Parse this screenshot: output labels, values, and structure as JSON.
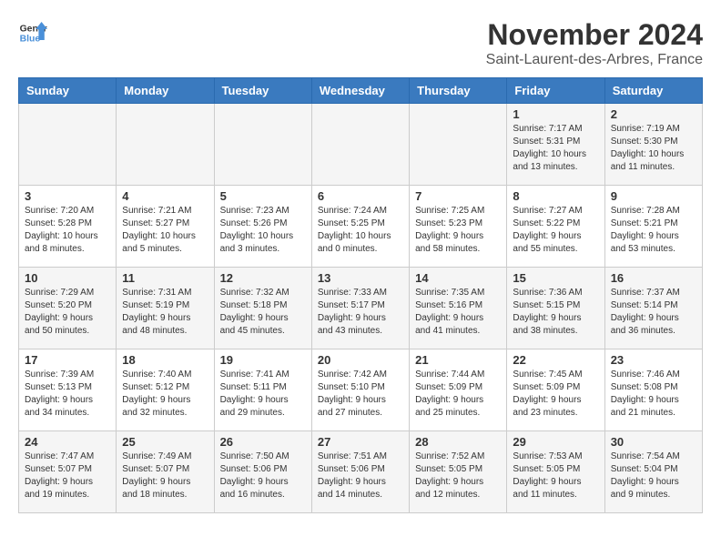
{
  "header": {
    "logo_general": "General",
    "logo_blue": "Blue",
    "month": "November 2024",
    "location": "Saint-Laurent-des-Arbres, France"
  },
  "weekdays": [
    "Sunday",
    "Monday",
    "Tuesday",
    "Wednesday",
    "Thursday",
    "Friday",
    "Saturday"
  ],
  "weeks": [
    [
      {
        "day": "",
        "content": ""
      },
      {
        "day": "",
        "content": ""
      },
      {
        "day": "",
        "content": ""
      },
      {
        "day": "",
        "content": ""
      },
      {
        "day": "",
        "content": ""
      },
      {
        "day": "1",
        "content": "Sunrise: 7:17 AM\nSunset: 5:31 PM\nDaylight: 10 hours and 13 minutes."
      },
      {
        "day": "2",
        "content": "Sunrise: 7:19 AM\nSunset: 5:30 PM\nDaylight: 10 hours and 11 minutes."
      }
    ],
    [
      {
        "day": "3",
        "content": "Sunrise: 7:20 AM\nSunset: 5:28 PM\nDaylight: 10 hours and 8 minutes."
      },
      {
        "day": "4",
        "content": "Sunrise: 7:21 AM\nSunset: 5:27 PM\nDaylight: 10 hours and 5 minutes."
      },
      {
        "day": "5",
        "content": "Sunrise: 7:23 AM\nSunset: 5:26 PM\nDaylight: 10 hours and 3 minutes."
      },
      {
        "day": "6",
        "content": "Sunrise: 7:24 AM\nSunset: 5:25 PM\nDaylight: 10 hours and 0 minutes."
      },
      {
        "day": "7",
        "content": "Sunrise: 7:25 AM\nSunset: 5:23 PM\nDaylight: 9 hours and 58 minutes."
      },
      {
        "day": "8",
        "content": "Sunrise: 7:27 AM\nSunset: 5:22 PM\nDaylight: 9 hours and 55 minutes."
      },
      {
        "day": "9",
        "content": "Sunrise: 7:28 AM\nSunset: 5:21 PM\nDaylight: 9 hours and 53 minutes."
      }
    ],
    [
      {
        "day": "10",
        "content": "Sunrise: 7:29 AM\nSunset: 5:20 PM\nDaylight: 9 hours and 50 minutes."
      },
      {
        "day": "11",
        "content": "Sunrise: 7:31 AM\nSunset: 5:19 PM\nDaylight: 9 hours and 48 minutes."
      },
      {
        "day": "12",
        "content": "Sunrise: 7:32 AM\nSunset: 5:18 PM\nDaylight: 9 hours and 45 minutes."
      },
      {
        "day": "13",
        "content": "Sunrise: 7:33 AM\nSunset: 5:17 PM\nDaylight: 9 hours and 43 minutes."
      },
      {
        "day": "14",
        "content": "Sunrise: 7:35 AM\nSunset: 5:16 PM\nDaylight: 9 hours and 41 minutes."
      },
      {
        "day": "15",
        "content": "Sunrise: 7:36 AM\nSunset: 5:15 PM\nDaylight: 9 hours and 38 minutes."
      },
      {
        "day": "16",
        "content": "Sunrise: 7:37 AM\nSunset: 5:14 PM\nDaylight: 9 hours and 36 minutes."
      }
    ],
    [
      {
        "day": "17",
        "content": "Sunrise: 7:39 AM\nSunset: 5:13 PM\nDaylight: 9 hours and 34 minutes."
      },
      {
        "day": "18",
        "content": "Sunrise: 7:40 AM\nSunset: 5:12 PM\nDaylight: 9 hours and 32 minutes."
      },
      {
        "day": "19",
        "content": "Sunrise: 7:41 AM\nSunset: 5:11 PM\nDaylight: 9 hours and 29 minutes."
      },
      {
        "day": "20",
        "content": "Sunrise: 7:42 AM\nSunset: 5:10 PM\nDaylight: 9 hours and 27 minutes."
      },
      {
        "day": "21",
        "content": "Sunrise: 7:44 AM\nSunset: 5:09 PM\nDaylight: 9 hours and 25 minutes."
      },
      {
        "day": "22",
        "content": "Sunrise: 7:45 AM\nSunset: 5:09 PM\nDaylight: 9 hours and 23 minutes."
      },
      {
        "day": "23",
        "content": "Sunrise: 7:46 AM\nSunset: 5:08 PM\nDaylight: 9 hours and 21 minutes."
      }
    ],
    [
      {
        "day": "24",
        "content": "Sunrise: 7:47 AM\nSunset: 5:07 PM\nDaylight: 9 hours and 19 minutes."
      },
      {
        "day": "25",
        "content": "Sunrise: 7:49 AM\nSunset: 5:07 PM\nDaylight: 9 hours and 18 minutes."
      },
      {
        "day": "26",
        "content": "Sunrise: 7:50 AM\nSunset: 5:06 PM\nDaylight: 9 hours and 16 minutes."
      },
      {
        "day": "27",
        "content": "Sunrise: 7:51 AM\nSunset: 5:06 PM\nDaylight: 9 hours and 14 minutes."
      },
      {
        "day": "28",
        "content": "Sunrise: 7:52 AM\nSunset: 5:05 PM\nDaylight: 9 hours and 12 minutes."
      },
      {
        "day": "29",
        "content": "Sunrise: 7:53 AM\nSunset: 5:05 PM\nDaylight: 9 hours and 11 minutes."
      },
      {
        "day": "30",
        "content": "Sunrise: 7:54 AM\nSunset: 5:04 PM\nDaylight: 9 hours and 9 minutes."
      }
    ]
  ]
}
